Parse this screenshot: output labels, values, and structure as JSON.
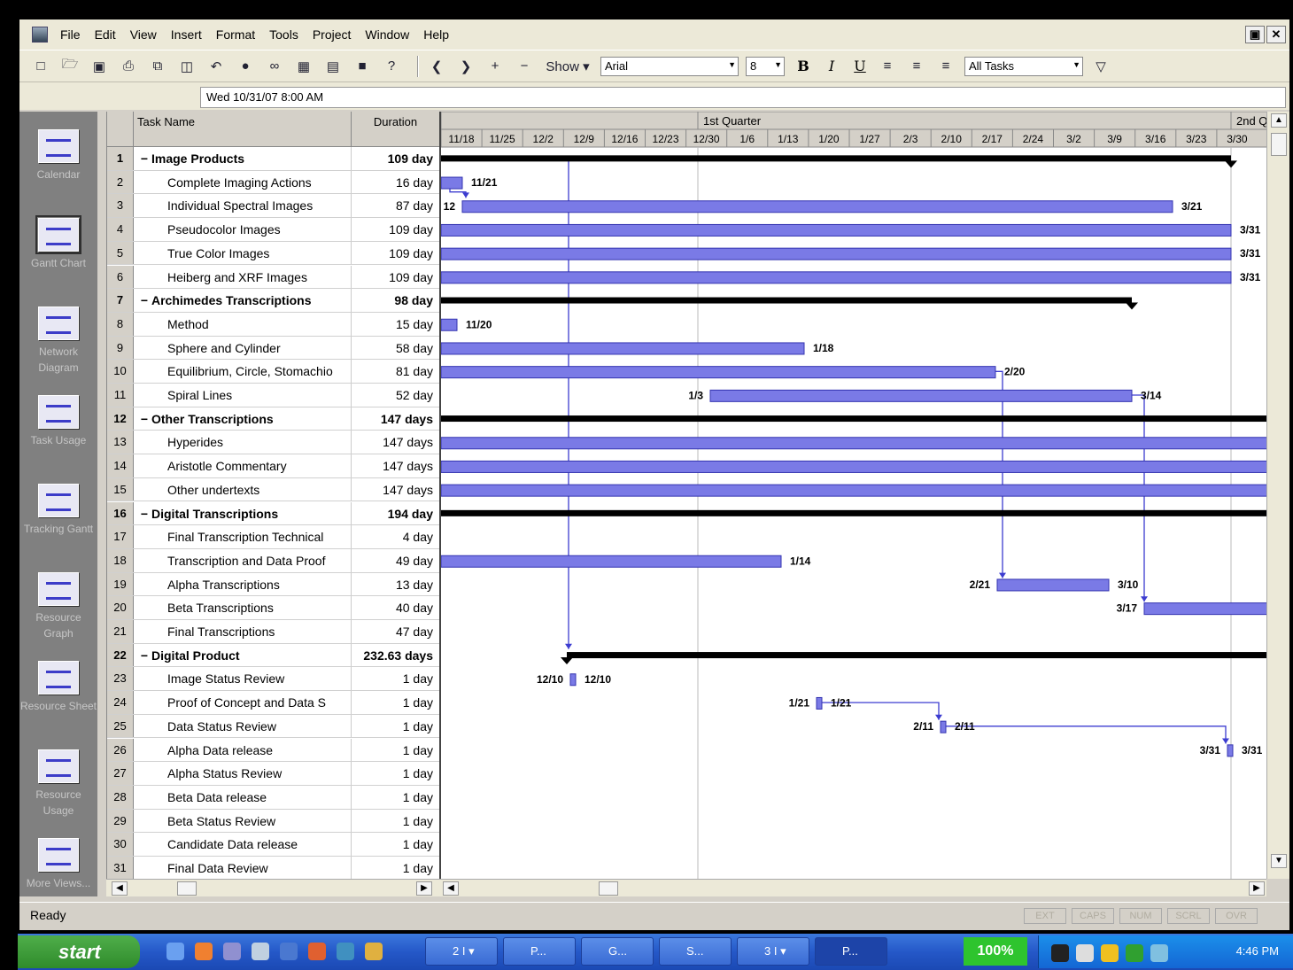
{
  "app": {
    "menu": [
      "File",
      "Edit",
      "View",
      "Insert",
      "Format",
      "Tools",
      "Project",
      "Window",
      "Help"
    ],
    "window_buttons": [
      "▣",
      "✕"
    ]
  },
  "toolbar": {
    "show_label": "Show ▾",
    "font_name": "Arial",
    "font_size": "8",
    "bold": "B",
    "italic": "I",
    "underline": "U",
    "filter": "All Tasks",
    "icons": [
      "new-file-icon",
      "open-folder-icon",
      "save-icon",
      "print-icon",
      "copy-icon",
      "paste-icon",
      "undo-icon",
      "globe-icon",
      "link-icon",
      "split-icon",
      "task-info-icon",
      "notes-icon",
      "help-icon"
    ]
  },
  "entry_bar": {
    "value": "Wed 10/31/07 8:00 AM"
  },
  "view_bar": [
    {
      "label": "Calendar",
      "icon": "calendar-icon",
      "selected": false
    },
    {
      "label": "Gantt Chart",
      "icon": "gantt-chart-icon",
      "selected": true
    },
    {
      "label": "Network Diagram",
      "icon": "network-diagram-icon",
      "selected": false
    },
    {
      "label": "Task Usage",
      "icon": "task-usage-icon",
      "selected": false
    },
    {
      "label": "Tracking Gantt",
      "icon": "tracking-gantt-icon",
      "selected": false
    },
    {
      "label": "Resource Graph",
      "icon": "resource-graph-icon",
      "selected": false
    },
    {
      "label": "Resource Sheet",
      "icon": "resource-sheet-icon",
      "selected": false
    },
    {
      "label": "Resource Usage",
      "icon": "resource-usage-icon",
      "selected": false
    },
    {
      "label": "More Views...",
      "icon": "more-views-icon",
      "selected": false
    }
  ],
  "grid": {
    "headers": {
      "name": "Task Name",
      "duration": "Duration"
    },
    "rows": [
      {
        "id": "1",
        "name": "Image Products",
        "duration": "109 day",
        "summary": true
      },
      {
        "id": "2",
        "name": "Complete Imaging Actions",
        "duration": "16 day",
        "summary": false
      },
      {
        "id": "3",
        "name": "Individual Spectral Images",
        "duration": "87 day",
        "summary": false
      },
      {
        "id": "4",
        "name": "Pseudocolor Images",
        "duration": "109 day",
        "summary": false
      },
      {
        "id": "5",
        "name": "True Color Images",
        "duration": "109 day",
        "summary": false
      },
      {
        "id": "6",
        "name": "Heiberg and XRF  Images",
        "duration": "109 day",
        "summary": false
      },
      {
        "id": "7",
        "name": "Archimedes Transcriptions",
        "duration": "98 day",
        "summary": true
      },
      {
        "id": "8",
        "name": "Method",
        "duration": "15 day",
        "summary": false
      },
      {
        "id": "9",
        "name": "Sphere and Cylinder",
        "duration": "58 day",
        "summary": false
      },
      {
        "id": "10",
        "name": "Equilibrium, Circle, Stomachio",
        "duration": "81 day",
        "summary": false
      },
      {
        "id": "11",
        "name": "Spiral Lines",
        "duration": "52 day",
        "summary": false
      },
      {
        "id": "12",
        "name": "Other Transcriptions",
        "duration": "147 days",
        "summary": true
      },
      {
        "id": "13",
        "name": "Hyperides",
        "duration": "147 days",
        "summary": false
      },
      {
        "id": "14",
        "name": "Aristotle Commentary",
        "duration": "147 days",
        "summary": false
      },
      {
        "id": "15",
        "name": "Other undertexts",
        "duration": "147 days",
        "summary": false
      },
      {
        "id": "16",
        "name": "Digital Transcriptions",
        "duration": "194 day",
        "summary": true
      },
      {
        "id": "17",
        "name": "Final Transcription Technical",
        "duration": "4 day",
        "summary": false
      },
      {
        "id": "18",
        "name": "Transcription and Data Proof",
        "duration": "49 day",
        "summary": false
      },
      {
        "id": "19",
        "name": "Alpha Transcriptions",
        "duration": "13 day",
        "summary": false
      },
      {
        "id": "20",
        "name": "Beta Transcriptions",
        "duration": "40 day",
        "summary": false
      },
      {
        "id": "21",
        "name": "Final Transcriptions",
        "duration": "47 day",
        "summary": false
      },
      {
        "id": "22",
        "name": "Digital Product",
        "duration": "232.63 days",
        "summary": true
      },
      {
        "id": "23",
        "name": "Image Status Review",
        "duration": "1 day",
        "summary": false
      },
      {
        "id": "24",
        "name": "Proof of Concept and Data S",
        "duration": "1 day",
        "summary": false
      },
      {
        "id": "25",
        "name": "Data Status Review",
        "duration": "1 day",
        "summary": false
      },
      {
        "id": "26",
        "name": "Alpha Data release",
        "duration": "1 day",
        "summary": false
      },
      {
        "id": "27",
        "name": "Alpha Status Review",
        "duration": "1 day",
        "summary": false
      },
      {
        "id": "28",
        "name": "Beta Data release",
        "duration": "1 day",
        "summary": false
      },
      {
        "id": "29",
        "name": "Beta Status Review",
        "duration": "1 day",
        "summary": false
      },
      {
        "id": "30",
        "name": "Candidate Data release",
        "duration": "1 day",
        "summary": false
      },
      {
        "id": "31",
        "name": "Final Data Review",
        "duration": "1 day",
        "summary": false
      }
    ]
  },
  "timescale": {
    "major": [
      "1st Quarter",
      "2nd Q"
    ],
    "minor": [
      "11/18",
      "11/25",
      "12/2",
      "12/9",
      "12/16",
      "12/23",
      "12/30",
      "1/6",
      "1/13",
      "1/20",
      "1/27",
      "2/3",
      "2/10",
      "2/17",
      "2/24",
      "3/2",
      "3/9",
      "3/16",
      "3/23",
      "3/30"
    ]
  },
  "gantt": {
    "colors": {
      "bar": "#7a7ae6",
      "bar_edge": "#3434b0",
      "summary": "#000000",
      "link": "#3c3cd0"
    },
    "bars": [
      {
        "row": 0,
        "start": 0,
        "end": 892,
        "summary": true
      },
      {
        "row": 1,
        "start": 0,
        "end": 24,
        "label_right": "11/21"
      },
      {
        "row": 2,
        "start": 24,
        "end": 826,
        "label_left": "12",
        "label_right": "3/21"
      },
      {
        "row": 3,
        "start": 0,
        "end": 892,
        "label_right": "3/31"
      },
      {
        "row": 4,
        "start": 0,
        "end": 892,
        "label_right": "3/31"
      },
      {
        "row": 5,
        "start": 0,
        "end": 892,
        "label_right": "3/31"
      },
      {
        "row": 6,
        "start": 0,
        "end": 780,
        "summary": true
      },
      {
        "row": 7,
        "start": 0,
        "end": 18,
        "label_right": "11/20"
      },
      {
        "row": 8,
        "start": 0,
        "end": 410,
        "label_right": "1/18"
      },
      {
        "row": 9,
        "start": 0,
        "end": 626,
        "label_right": "2/20"
      },
      {
        "row": 10,
        "start": 304,
        "end": 780,
        "label_left": "1/3",
        "label_right": "3/14"
      },
      {
        "row": 11,
        "start": 0,
        "end": 934,
        "summary": true
      },
      {
        "row": 12,
        "start": 0,
        "end": 934
      },
      {
        "row": 13,
        "start": 0,
        "end": 934
      },
      {
        "row": 14,
        "start": 0,
        "end": 934
      },
      {
        "row": 15,
        "start": 0,
        "end": 934,
        "summary": true
      },
      {
        "row": 17,
        "start": 0,
        "end": 384,
        "label_right": "1/14"
      },
      {
        "row": 18,
        "start": 628,
        "end": 754,
        "label_left": "2/21",
        "label_right": "3/10"
      },
      {
        "row": 19,
        "start": 794,
        "end": 934,
        "label_left": "3/17"
      },
      {
        "row": 21,
        "start": 142,
        "end": 934,
        "summary": true
      },
      {
        "row": 22,
        "start": 146,
        "end": 152,
        "label_left": "12/10",
        "label_right": "12/10"
      },
      {
        "row": 23,
        "start": 424,
        "end": 430,
        "label_left": "1/21",
        "label_right": "1/21"
      },
      {
        "row": 24,
        "start": 564,
        "end": 570,
        "label_left": "2/11",
        "label_right": "2/11"
      },
      {
        "row": 25,
        "start": 888,
        "end": 894,
        "label_left": "3/31",
        "label_right": "3/31"
      }
    ]
  },
  "status": {
    "text": "Ready",
    "indicators": [
      "EXT",
      "CAPS",
      "NUM",
      "SCRL",
      "OVR"
    ]
  },
  "taskbar": {
    "start": "start",
    "buttons": [
      "2 I ▾",
      "P...",
      "G...",
      "S...",
      "3 I ▾",
      "P..."
    ],
    "zoom": "100%",
    "clock": "4:46 PM"
  }
}
